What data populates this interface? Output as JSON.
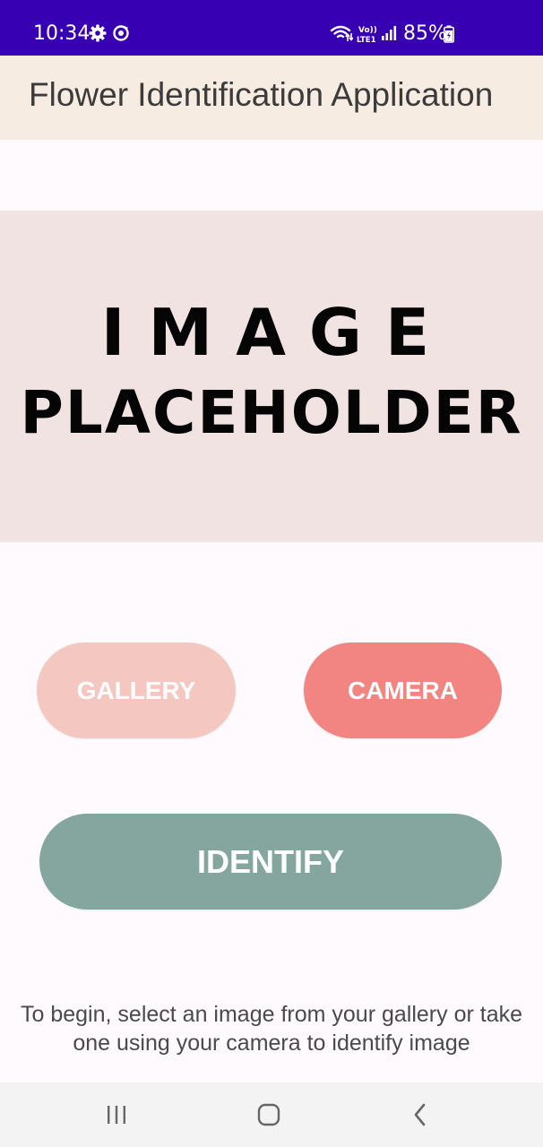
{
  "status_bar": {
    "time": "10:34",
    "battery": "85%",
    "background": "#3700b3",
    "icons": [
      "settings-gear-icon",
      "sync-icon",
      "wifi-icon",
      "volte-icon",
      "signal-icon",
      "battery-charging-icon"
    ],
    "volte_label": "Vo))\nLTE1"
  },
  "app_bar": {
    "title": "Flower Identification Application",
    "background": "#f7ece2"
  },
  "image_placeholder": {
    "line1": "IMAGE",
    "line2": "PLACEHOLDER",
    "background": "#f2e3e3"
  },
  "buttons": {
    "gallery": {
      "label": "GALLERY",
      "color": "#f4c8c1"
    },
    "camera": {
      "label": "CAMERA",
      "color": "#f28581"
    },
    "identify": {
      "label": "IDENTIFY",
      "color": "#84a69f"
    }
  },
  "instructions": "To begin, select an image from your gallery or take one using your camera to identify image",
  "nav_bar": {
    "icons": [
      "recent-apps-icon",
      "home-icon",
      "back-icon"
    ]
  }
}
